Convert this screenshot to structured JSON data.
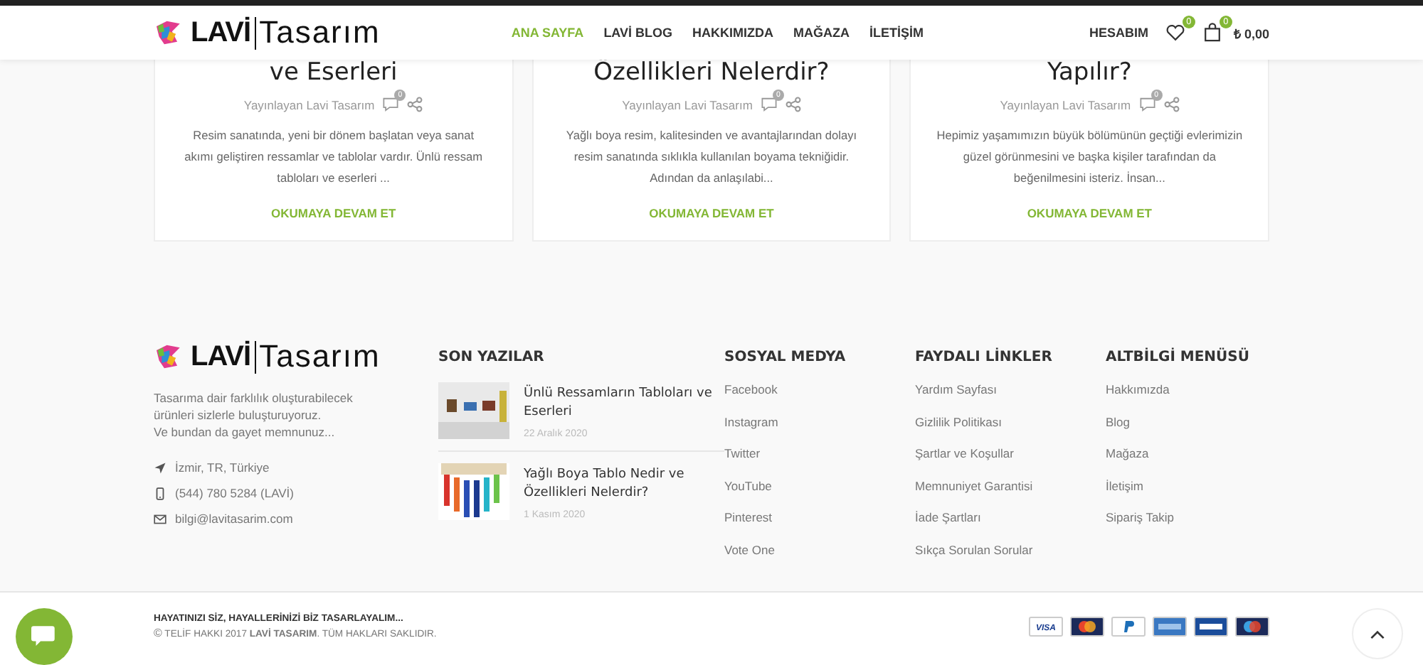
{
  "header": {
    "logo": {
      "mark": "LAVİ",
      "word": "Tasarım"
    },
    "nav": [
      {
        "label": "ANA SAYFA",
        "selected": true
      },
      {
        "label": "LAVİ BLOG",
        "selected": false
      },
      {
        "label": "HAKKIMIZDA",
        "selected": false
      },
      {
        "label": "MAĞAZA",
        "selected": false
      },
      {
        "label": "İLETİŞİM",
        "selected": false
      }
    ],
    "account": "HESABIM",
    "wishlist_count": "0",
    "cart_count": "0",
    "cart_total": "₺ 0,00"
  },
  "posts": [
    {
      "title": "ve Eserleri",
      "author": "Yayınlayan Lavi Tasarım",
      "comments": "0",
      "excerpt": "Resim sanatında, yeni bir dönem başlatan veya sanat akımı geliştiren ressamlar ve tablolar vardır. Ünlü ressam tabloları ve eserleri ...",
      "more": "OKUMAYA DEVAM ET"
    },
    {
      "title": "Özellikleri Nelerdir?",
      "author": "Yayınlayan Lavi Tasarım",
      "comments": "0",
      "excerpt": "Yağlı boya resim, kalitesinden ve avantajlarından dolayı resim sanatında sıklıkla kullanılan boyama tekniğidir. Adından da anlaşılabi...",
      "more": "OKUMAYA DEVAM ET"
    },
    {
      "title": "Yapılır?",
      "author": "Yayınlayan Lavi Tasarım",
      "comments": "0",
      "excerpt": "Hepimiz yaşamımızın büyük bölümünün geçtiği evlerimizin güzel görünmesini ve başka kişiler tarafından da beğenilmesini isteriz. İnsan...",
      "more": "OKUMAYA DEVAM ET"
    }
  ],
  "footer": {
    "logo": {
      "mark": "LAVİ",
      "word": "Tasarım"
    },
    "about": [
      "Tasarıma dair farklılık oluşturabilecek",
      "ürünleri sizlerle buluşturuyoruz.",
      "Ve bundan da gayet memnunuz..."
    ],
    "contacts": [
      {
        "kind": "location",
        "text": "İzmir, TR, Türkiye"
      },
      {
        "kind": "phone",
        "text": "(544) 780 5284 (LAVİ)"
      },
      {
        "kind": "mail",
        "text": "bilgi@lavitasarim.com"
      }
    ],
    "recent": {
      "title": "SON YAZILAR",
      "items": [
        {
          "kind": "gallery",
          "title": "Ünlü Ressamların Tabloları ve Eserleri",
          "date": "22 Aralık 2020"
        },
        {
          "kind": "brushes",
          "title": "Yağlı Boya Tablo Nedir ve Özellikleri Nelerdir?",
          "date": "1 Kasım 2020"
        }
      ]
    },
    "columns": [
      {
        "title": "SOSYAL MEDYA",
        "links": [
          "Facebook",
          "Instagram",
          "Twitter",
          "YouTube",
          "Pinterest",
          "Vote One"
        ]
      },
      {
        "title": "FAYDALI LİNKLER",
        "links": [
          "Yardım Sayfası",
          "Gizlilik Politikası",
          "Şartlar ve Koşullar",
          "Memnuniyet Garantisi",
          "İade Şartları",
          "Sıkça Sorulan Sorular"
        ]
      },
      {
        "title": "ALTBİLGİ MENÜSÜ",
        "links": [
          "Hakkımızda",
          "Blog",
          "Mağaza",
          "İletişim",
          "Sipariş Takip"
        ]
      }
    ]
  },
  "bottom": {
    "slogan": "HAYATINIZI SİZ, HAYALLERİNİZİ BİZ TASARLAYALIM...",
    "copyright": "TELİF HAKKI 2017 **LAVİ TASARIM**. TÜM HAKLARI SAKLIDIR.",
    "copy_sign": "©",
    "payments": [
      {
        "kind": "visa",
        "label": "VISA"
      },
      {
        "kind": "mastercard"
      },
      {
        "kind": "paypal"
      },
      {
        "kind": "amex"
      },
      {
        "kind": "visa-electron"
      },
      {
        "kind": "maestro"
      }
    ]
  }
}
